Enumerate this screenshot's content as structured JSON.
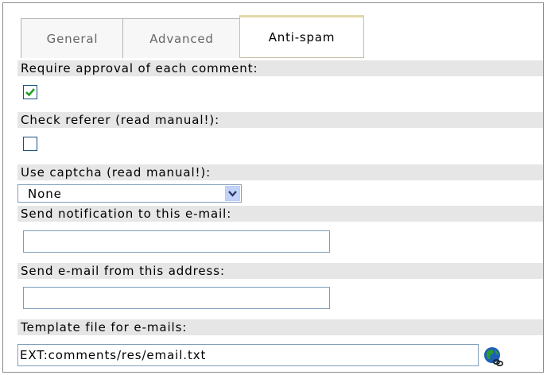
{
  "tabs": [
    {
      "label": "General"
    },
    {
      "label": "Advanced"
    },
    {
      "label": "Anti-spam"
    }
  ],
  "active_tab": "Anti-spam",
  "fields": {
    "require_approval": {
      "label": "Require approval of each comment:",
      "checked": true
    },
    "check_referer": {
      "label": "Check referer (read manual!):",
      "checked": false
    },
    "use_captcha": {
      "label": "Use captcha (read manual!):",
      "selected": "None"
    },
    "notify_email": {
      "label": "Send notification to this e-mail:",
      "value": ""
    },
    "from_email": {
      "label": "Send e-mail from this address:",
      "value": ""
    },
    "template_file": {
      "label": "Template file for e-mails:",
      "value": "EXT:comments/res/email.txt"
    }
  },
  "icons": {
    "checkmark": "checkmark-icon",
    "dropdown_arrow": "chevron-down-icon",
    "wizard": "globe-link-icon"
  },
  "colors": {
    "label_row_bg": "#e6e6e6",
    "checkbox_border": "#1c5180",
    "check_green": "#21a121",
    "input_border": "#7f9db9",
    "active_tab_accent": "#e3d9a8"
  }
}
